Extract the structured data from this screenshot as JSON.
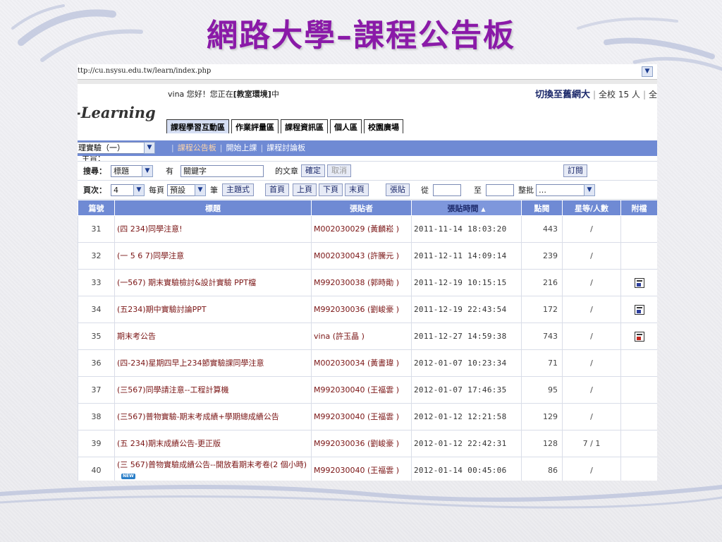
{
  "slide": {
    "title": "網路大學–課程公告板"
  },
  "browser": {
    "url": "ttp://cu.nsysu.edu.tw/learn/index.php"
  },
  "header": {
    "logo": "-Learning",
    "greeting_prefix": "vina 您好！您正在",
    "greeting_place": "[教室環境]",
    "greeting_suffix": "中",
    "switch_label": "切換至舊網大",
    "online_label": "全校 15 人",
    "online_more": "全"
  },
  "tabs": [
    {
      "label": "課程學習互動區"
    },
    {
      "label": "作業評量區"
    },
    {
      "label": "課程資訊區"
    },
    {
      "label": "個人區"
    },
    {
      "label": "校園廣場"
    }
  ],
  "nav": {
    "course_select": "理實驗（一）",
    "links": [
      {
        "label": "課程公告板"
      },
      {
        "label": "開始上課"
      },
      {
        "label": "課程討論板"
      }
    ]
  },
  "topic_label": "主旨：",
  "search": {
    "label": "搜尋：",
    "field_select": "標題",
    "has_label": "有",
    "keyword_value": "關鍵字",
    "article_label": "的文章",
    "confirm_button": "確定",
    "cancel_button": "取消",
    "subscribe_button": "訂閱"
  },
  "pager": {
    "label": "頁次：",
    "page_value": "4",
    "per_page_label": "每頁",
    "per_page_value": "預設",
    "unit_label": "筆",
    "thread_mode_button": "主題式",
    "first_button": "首頁",
    "prev_button": "上頁",
    "next_button": "下頁",
    "last_button": "末頁",
    "paste_button": "張貼",
    "from_label": "從",
    "to_label": "至",
    "batch_label": "整批",
    "batch_value": "…"
  },
  "table": {
    "headers": {
      "no": "篇號",
      "title": "標題",
      "poster": "張貼者",
      "time": "張貼時間",
      "sort_icon": "▲",
      "views": "點閱",
      "rating": "星等/人數",
      "attach": "附檔"
    },
    "rows": [
      {
        "no": "31",
        "title": "(四 234)同學注意!",
        "poster": "M002030029 (黃麟崧 )",
        "time": "2011-11-14 18:03:20",
        "views": "443",
        "rating": "/",
        "attach": ""
      },
      {
        "no": "32",
        "title": "(一 5 6 7)同學注意",
        "poster": "M002030043 (許騰元 )",
        "time": "2011-12-11 14:09:14",
        "views": "239",
        "rating": "/",
        "attach": ""
      },
      {
        "no": "33",
        "title": "(一567) 期末實驗檢討&設計實驗 PPT檔",
        "poster": "M992030038 (郭時勛 )",
        "time": "2011-12-19 10:15:15",
        "views": "216",
        "rating": "/",
        "attach": "doc"
      },
      {
        "no": "34",
        "title": "(五234)期中實驗討論PPT",
        "poster": "M992030036 (劉峻豪 )",
        "time": "2011-12-19 22:43:54",
        "views": "172",
        "rating": "/",
        "attach": "doc"
      },
      {
        "no": "35",
        "title": "期末考公告",
        "poster": "vina (許玉晶 )",
        "time": "2011-12-27 14:59:38",
        "views": "743",
        "rating": "/",
        "attach": "pdf"
      },
      {
        "no": "36",
        "title": "(四-234)星期四早上234節實驗課同學注意",
        "poster": "M002030034 (黃書瑋 )",
        "time": "2012-01-07 10:23:34",
        "views": "71",
        "rating": "/",
        "attach": ""
      },
      {
        "no": "37",
        "title": "(三567)同學請注意--工程計算機",
        "poster": "M992030040 (王福雲 )",
        "time": "2012-01-07 17:46:35",
        "views": "95",
        "rating": "/",
        "attach": ""
      },
      {
        "no": "38",
        "title": "(三567)普物實驗-期末考成績+學期總成績公告",
        "poster": "M992030040 (王福雲 )",
        "time": "2012-01-12 12:21:58",
        "views": "129",
        "rating": "/",
        "attach": ""
      },
      {
        "no": "39",
        "title": "(五 234)期末成績公告-更正版",
        "poster": "M992030036 (劉峻豪 )",
        "time": "2012-01-12 22:42:31",
        "views": "128",
        "rating": "7 / 1",
        "attach": ""
      },
      {
        "no": "40",
        "title": "(三 567)普物實驗成績公告--開放看期末考卷(2 個小時)",
        "poster": "M992030040 (王福雲 )",
        "time": "2012-01-14 00:45:06",
        "views": "86",
        "rating": "/",
        "attach": "",
        "new_badge": "NEW"
      }
    ]
  }
}
